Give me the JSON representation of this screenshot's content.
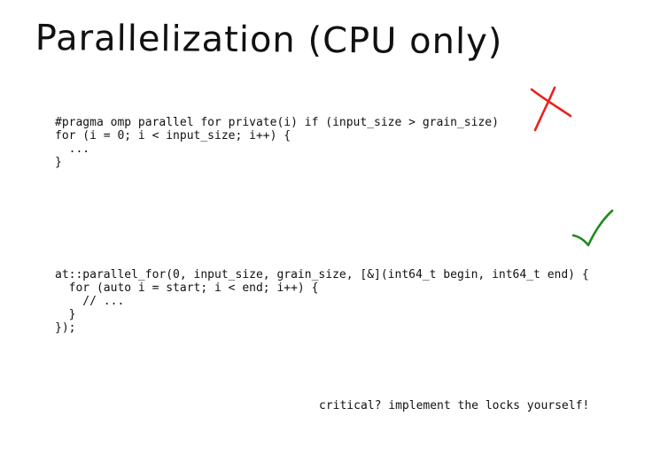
{
  "slide": {
    "title": "Parallelization (CPU only)",
    "code_block_1": [
      "#pragma omp parallel for private(i) if (input_size > grain_size)",
      "for (i = 0; i < input_size; i++) {",
      "  ...",
      "}"
    ],
    "code_block_2": [
      "at::parallel_for(0, input_size, grain_size, [&](int64_t begin, int64_t end) {",
      "  for (auto i = start; i < end; i++) {",
      "    // ...",
      "  }",
      "});"
    ],
    "note": "critical? implement the locks yourself!",
    "marks": {
      "cross": {
        "icon": "cross-icon",
        "color": "#e8221f"
      },
      "check": {
        "icon": "check-icon",
        "color": "#1f8a1f"
      }
    }
  }
}
